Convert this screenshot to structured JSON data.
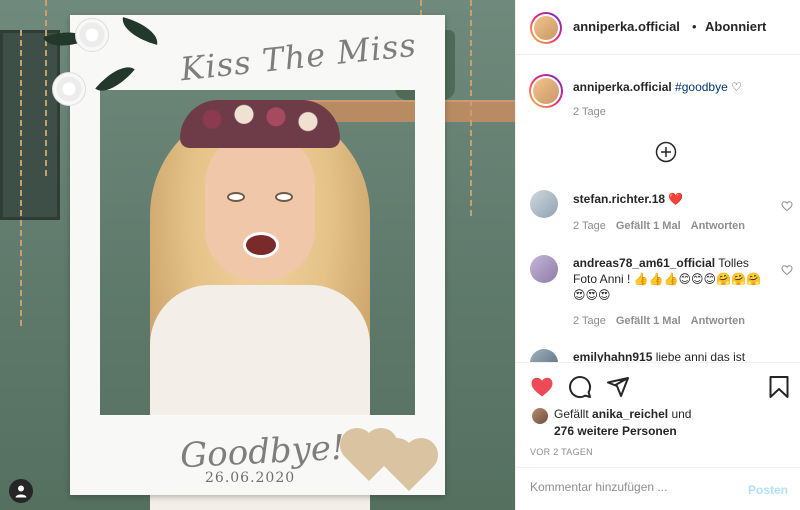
{
  "post": {
    "username": "anniperka.official",
    "separator": "•",
    "follow_status": "Abonniert",
    "photo": {
      "frame_title": "Kiss The Miss",
      "frame_goodbye": "Goodbye!",
      "frame_date": "26.06.2020"
    }
  },
  "caption": {
    "username": "anniperka.official",
    "hashtag": "#goodbye",
    "emoji": "♡",
    "age": "2 Tage"
  },
  "comments": [
    {
      "username": "stefan.richter.18",
      "text": "❤️",
      "age": "2 Tage",
      "likes": "Gefällt 1 Mal",
      "reply": "Antworten"
    },
    {
      "username": "andreas78_am61_official",
      "text": "Tolles Foto Anni ! 👍👍👍😊😊😊🤗🤗🤗😍😍😍",
      "age": "2 Tage",
      "likes": "Gefällt 1 Mal",
      "reply": "Antworten"
    },
    {
      "username": "emilyhahn915",
      "text": "liebe anni das ist",
      "age": "",
      "likes": "",
      "reply": ""
    }
  ],
  "likes": {
    "prefix": "Gefällt",
    "user": "anika_reichel",
    "connector": "und",
    "others": "276 weitere Personen"
  },
  "timestamp": "VOR 2 TAGEN",
  "add_comment": {
    "placeholder": "Kommentar hinzufügen ...",
    "post_label": "Posten"
  },
  "colors": {
    "like_red": "#ed4956",
    "link_blue": "#00376b",
    "post_disabled": "#b2dffc"
  },
  "icons": [
    "heart-icon",
    "comment-icon",
    "share-icon",
    "bookmark-icon",
    "plus-circle-icon",
    "tag-user-icon"
  ]
}
